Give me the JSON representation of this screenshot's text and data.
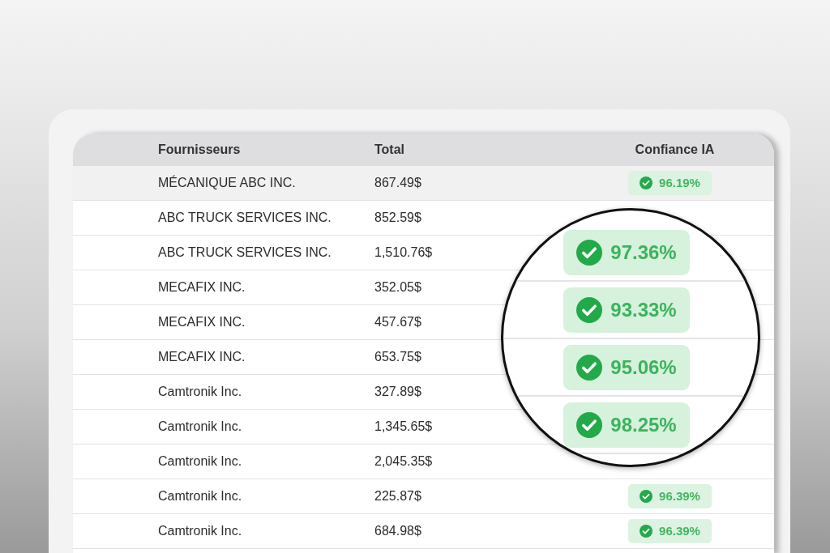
{
  "table": {
    "columns": [
      "Fournisseurs",
      "Total",
      "Confiance IA"
    ],
    "rows": [
      {
        "supplier": "MÉCANIQUE ABC INC.",
        "total": "867.49$",
        "confidence": "96.19%",
        "selected": true
      },
      {
        "supplier": "ABC TRUCK SERVICES INC.",
        "total": "852.59$",
        "selected": false
      },
      {
        "supplier": "ABC TRUCK SERVICES INC.",
        "total": "1,510.76$",
        "selected": false
      },
      {
        "supplier": "MECAFIX INC.",
        "total": "352.05$",
        "selected": false
      },
      {
        "supplier": "MECAFIX INC.",
        "total": "457.67$",
        "selected": false
      },
      {
        "supplier": "MECAFIX INC.",
        "total": "653.75$",
        "selected": false
      },
      {
        "supplier": "Camtronik Inc.",
        "total": "327.89$",
        "selected": false
      },
      {
        "supplier": "Camtronik Inc.",
        "total": "1,345.65$",
        "selected": false
      },
      {
        "supplier": "Camtronik Inc.",
        "total": "2,045.35$",
        "selected": false
      },
      {
        "supplier": "Camtronik Inc.",
        "total": "225.87$",
        "confidence": "96.39%",
        "selected": false
      },
      {
        "supplier": "Camtronik Inc.",
        "total": "684.98$",
        "confidence": "96.39%",
        "selected": false
      }
    ]
  },
  "magnifier": {
    "badges": [
      "97.36%",
      "93.33%",
      "95.06%",
      "98.25%"
    ]
  }
}
